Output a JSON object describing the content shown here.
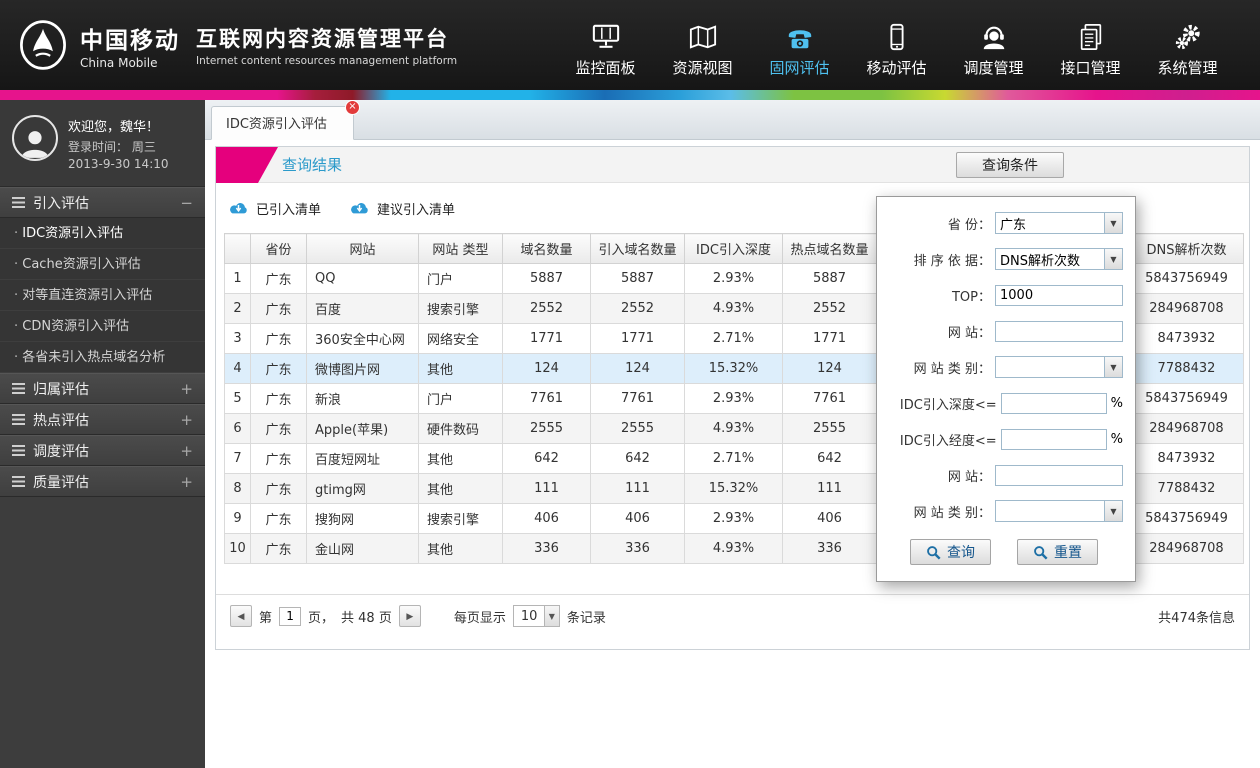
{
  "brand_colors": {
    "header_bg": "#1d1d1d",
    "nav_active_blue": "#4fc1f0",
    "ribbon_magenta": "#e5007d",
    "panel_title_blue": "#2b9aca",
    "selected_row_bg": "#ddeefb",
    "toolbar_icon_blue": "#2f9bd6"
  },
  "header": {
    "logo_cn": "中国移动",
    "logo_en": "China Mobile",
    "title_cn": "互联网内容资源管理平台",
    "title_en": "Internet content resources management platform",
    "nav": [
      {
        "label": "监控面板",
        "icon": "dashboard-icon",
        "active": false
      },
      {
        "label": "资源视图",
        "icon": "map-icon",
        "active": false
      },
      {
        "label": "固网评估",
        "icon": "phone-icon",
        "active": true
      },
      {
        "label": "移动评估",
        "icon": "mobile-icon",
        "active": false
      },
      {
        "label": "调度管理",
        "icon": "headset-icon",
        "active": false
      },
      {
        "label": "接口管理",
        "icon": "documents-icon",
        "active": false
      },
      {
        "label": "系统管理",
        "icon": "gears-icon",
        "active": false
      }
    ]
  },
  "sidebar": {
    "welcome": "欢迎您，魏华！",
    "login_label": "登录时间：  周三",
    "login_time": "2013-9-30   14:10",
    "sections": [
      {
        "label": "引入评估",
        "expanded": true,
        "items": [
          {
            "label": "IDC资源引入评估",
            "active": true
          },
          {
            "label": "Cache资源引入评估",
            "active": false
          },
          {
            "label": "对等直连资源引入评估",
            "active": false
          },
          {
            "label": "CDN资源引入评估",
            "active": false
          },
          {
            "label": "各省未引入热点域名分析",
            "active": false
          }
        ]
      },
      {
        "label": "归属评估",
        "expanded": false,
        "items": []
      },
      {
        "label": "热点评估",
        "expanded": false,
        "items": []
      },
      {
        "label": "调度评估",
        "expanded": false,
        "items": []
      },
      {
        "label": "质量评估",
        "expanded": false,
        "items": []
      }
    ]
  },
  "main": {
    "tab_label": "IDC资源引入评估",
    "panel_title": "查询结果",
    "query_conditions_button": "查询条件",
    "toolbar_buttons": [
      {
        "label": "已引入清单",
        "icon": "cloud-download-icon"
      },
      {
        "label": "建议引入清单",
        "icon": "cloud-download-icon"
      }
    ],
    "table": {
      "columns": [
        "",
        "省份",
        "网站",
        "网站 类型",
        "域名数量",
        "引入域名数量",
        "IDC引入深度",
        "热点域名数量",
        "",
        "DNS解析次数"
      ],
      "rows": [
        {
          "selected": false,
          "cells": [
            "1",
            "广东",
            "QQ",
            "门户",
            "5887",
            "5887",
            "2.93%",
            "5887",
            "",
            "5843756949"
          ]
        },
        {
          "selected": false,
          "cells": [
            "2",
            "广东",
            "百度",
            "搜索引擎",
            "2552",
            "2552",
            "4.93%",
            "2552",
            "",
            "284968708"
          ]
        },
        {
          "selected": false,
          "cells": [
            "3",
            "广东",
            "360安全中心网",
            "网络安全",
            "1771",
            "1771",
            "2.71%",
            "1771",
            "",
            "8473932"
          ]
        },
        {
          "selected": true,
          "cells": [
            "4",
            "广东",
            "微博图片网",
            "其他",
            "124",
            "124",
            "15.32%",
            "124",
            "",
            "7788432"
          ]
        },
        {
          "selected": false,
          "cells": [
            "5",
            "广东",
            "新浪",
            "门户",
            "7761",
            "7761",
            "2.93%",
            "7761",
            "",
            "5843756949"
          ]
        },
        {
          "selected": false,
          "cells": [
            "6",
            "广东",
            "Apple(苹果)",
            "硬件数码",
            "2555",
            "2555",
            "4.93%",
            "2555",
            "",
            "284968708"
          ]
        },
        {
          "selected": false,
          "cells": [
            "7",
            "广东",
            "百度短网址",
            "其他",
            "642",
            "642",
            "2.71%",
            "642",
            "",
            "8473932"
          ]
        },
        {
          "selected": false,
          "cells": [
            "8",
            "广东",
            "gtimg网",
            "其他",
            "111",
            "111",
            "15.32%",
            "111",
            "",
            "7788432"
          ]
        },
        {
          "selected": false,
          "cells": [
            "9",
            "广东",
            "搜狗网",
            "搜索引擎",
            "406",
            "406",
            "2.93%",
            "406",
            "",
            "5843756949"
          ]
        },
        {
          "selected": false,
          "cells": [
            "10",
            "广东",
            "金山网",
            "其他",
            "336",
            "336",
            "4.93%",
            "336",
            "",
            "284968708"
          ]
        }
      ]
    },
    "pagination": {
      "page_prefix": "第",
      "current_page": "1",
      "page_suffix": "页，",
      "total_pages": "共 48 页",
      "per_page_label": "每页显示",
      "per_page_value": "10",
      "per_page_suffix": "条记录",
      "total_records": "共474条信息"
    }
  },
  "query_panel": {
    "fields": [
      {
        "label": "省 份：",
        "type": "select",
        "value": "广东"
      },
      {
        "label": "排 序 依 据：",
        "type": "select",
        "value": "DNS解析次数"
      },
      {
        "label": "TOP：",
        "type": "text",
        "value": "1000"
      },
      {
        "label": "网 站：",
        "type": "text",
        "value": ""
      },
      {
        "label": "网 站 类 别：",
        "type": "select",
        "value": ""
      },
      {
        "label": "IDC引入深度<=",
        "type": "text",
        "value": "",
        "suffix": "%"
      },
      {
        "label": "IDC引入经度<=",
        "type": "text",
        "value": "",
        "suffix": "%"
      },
      {
        "label": "网 站：",
        "type": "text",
        "value": ""
      },
      {
        "label": "网 站 类 别：",
        "type": "select",
        "value": ""
      }
    ],
    "buttons": [
      {
        "label": "查询",
        "icon": "magnifier-icon"
      },
      {
        "label": "重置",
        "icon": "magnifier-icon"
      }
    ]
  }
}
